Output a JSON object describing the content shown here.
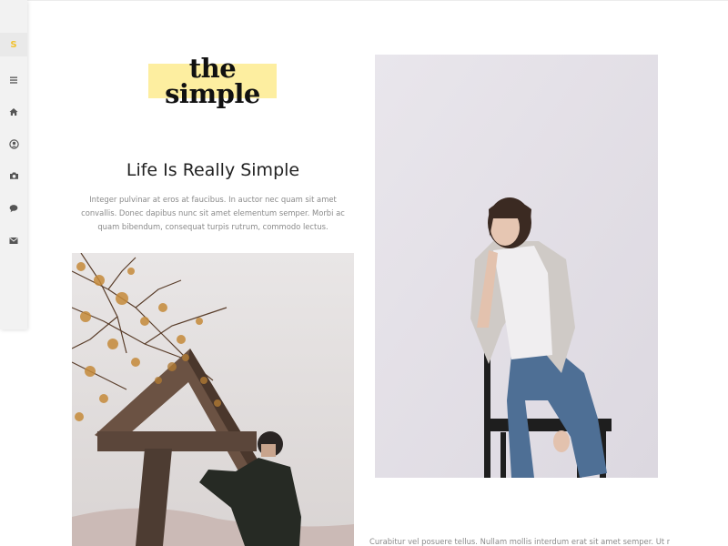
{
  "colors": {
    "accent": "#f2c230",
    "logo_highlight": "#fdeea0",
    "sidebar_bg": "#f2f2f2",
    "icon": "#555555"
  },
  "sidebar": {
    "logo_letter": "S",
    "icons": [
      "menu-icon",
      "home-icon",
      "user-icon",
      "camera-icon",
      "chat-icon",
      "mail-icon"
    ]
  },
  "logo": {
    "line1": "the",
    "line2": "simple"
  },
  "main": {
    "title": "Life Is Really Simple",
    "intro": "Integer pulvinar at eros at faucibus. In auctor nec quam sit amet convallis. Donec dapibus nunc sit amet elementum semper. Morbi ac quam bibendum, consequat turpis rutrum, commodo lectus.",
    "bottom_text": "Curabitur vel posuere tellus. Nullam mollis interdum erat sit amet semper. Ut nec fringilla"
  }
}
